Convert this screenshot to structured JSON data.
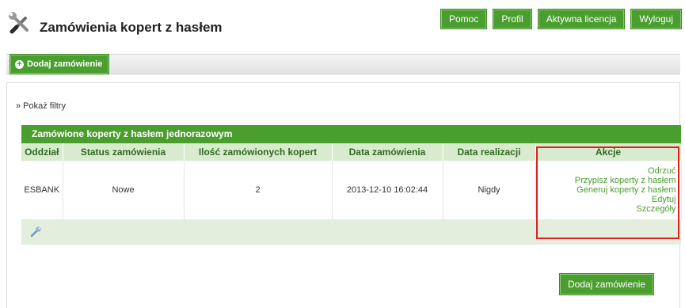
{
  "header": {
    "title": "Zamówienia kopert z hasłem",
    "icon": "tools-icon",
    "nav": [
      "Pomoc",
      "Profil",
      "Aktywna licencja",
      "Wyloguj"
    ]
  },
  "toolbar": {
    "add_order_label": "Dodaj zamówienie"
  },
  "filters": {
    "show_label": "» Pokaż filtry"
  },
  "orders_table": {
    "title": "Zamówione koperty z hasłem jednorazowym",
    "columns": [
      "Oddział",
      "Status zamówienia",
      "Ilość zamówionych kopert",
      "Data zamówienia",
      "Data realizacji",
      "Akcje"
    ],
    "rows": [
      {
        "branch": "ESBANK",
        "status": "Nowe",
        "quantity": "2",
        "order_date": "2013-12-10 16:02:44",
        "completion_date": "Nigdy",
        "actions": [
          "Odrzuć",
          "Przypisz koperty z hasłem",
          "Generuj koperty z hasłem",
          "Edytuj",
          "Szczegóły"
        ]
      }
    ]
  },
  "bottom": {
    "add_order_label": "Dodaj zamówienie"
  },
  "colors": {
    "accent_green": "#4a9e2e",
    "header_row_bg": "#d9ebcf",
    "highlight": "#e02020"
  }
}
